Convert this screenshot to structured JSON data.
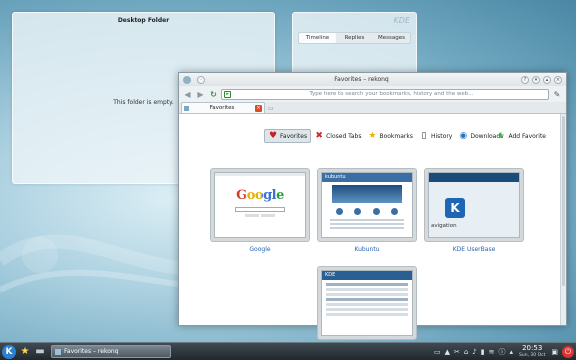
{
  "desktop_folder": {
    "title": "Desktop Folder",
    "empty_message": "This folder is empty."
  },
  "microblog": {
    "logo_text": "KDE",
    "tabs": [
      "Timeline",
      "Replies",
      "Messages"
    ]
  },
  "window": {
    "title": "Favorites – rekonq",
    "url_placeholder": "Type here to search your bookmarks, history and the web...",
    "tab": {
      "label": "Favorites"
    },
    "nav": {
      "items": [
        {
          "label": "Favorites",
          "icon": "heart-icon",
          "selected": true
        },
        {
          "label": "Closed Tabs",
          "icon": "closed-tabs-icon",
          "selected": false
        },
        {
          "label": "Bookmarks",
          "icon": "star-icon",
          "selected": false
        },
        {
          "label": "History",
          "icon": "history-icon",
          "selected": false
        },
        {
          "label": "Downloads",
          "icon": "download-icon",
          "selected": false
        }
      ],
      "add_favorite": "Add Favorite"
    },
    "favorites": [
      {
        "caption": "Google",
        "thumb_text": "Google"
      },
      {
        "caption": "Kubuntu",
        "thumb_text": "kubuntu"
      },
      {
        "caption": "KDE UserBase",
        "thumb_text": "avigation"
      },
      {
        "caption": "",
        "thumb_text": "KDE"
      }
    ]
  },
  "taskbar": {
    "task_label": "Favorites – rekonq",
    "clock": {
      "time": "20:53",
      "date": "Sun, 30 Oct"
    },
    "colors": {
      "accent": "#2f7fd0",
      "leave": "#dd3333"
    }
  }
}
